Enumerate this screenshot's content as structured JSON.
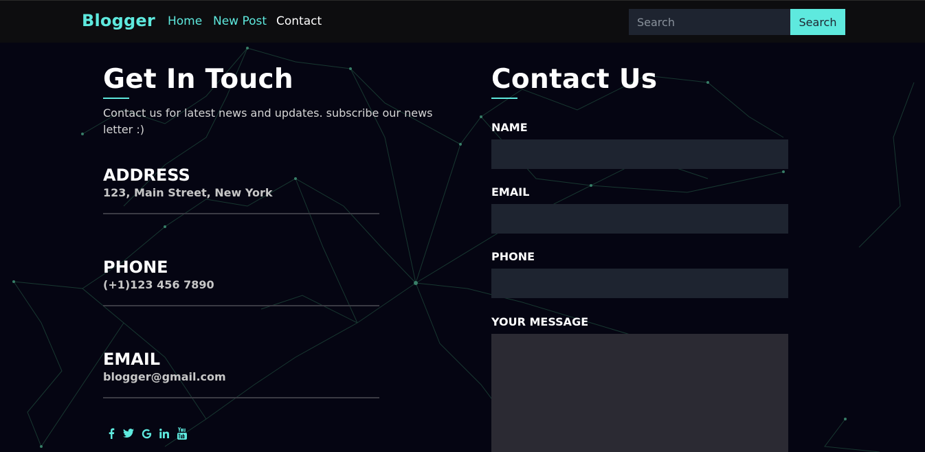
{
  "navbar": {
    "brand": "Blogger",
    "links": [
      "Home",
      "New Post",
      "Contact"
    ],
    "search_placeholder": "Search",
    "search_button": "Search"
  },
  "left": {
    "title": "Get In Touch",
    "intro": "Contact us for latest news and updates. subscribe our news letter :)",
    "address_title": "ADDRESS",
    "address_value": "123, Main Street, New York",
    "phone_title": "PHONE",
    "phone_value": "(+1)123 456 7890",
    "email_title": "EMAIL",
    "email_value": "blogger@gmail.com",
    "social_icons": [
      "facebook-icon",
      "twitter-icon",
      "google-icon",
      "linkedin-icon",
      "youtube-icon"
    ]
  },
  "right": {
    "title": "Contact Us",
    "name_label": "NAME",
    "email_label": "EMAIL",
    "phone_label": "PHONE",
    "message_label": "YOUR MESSAGE"
  },
  "colors": {
    "accent": "#5ee9de",
    "background": "#050512",
    "navbar": "#0d0d0f",
    "field": "#1e2430",
    "message_field": "#2b2a33"
  }
}
